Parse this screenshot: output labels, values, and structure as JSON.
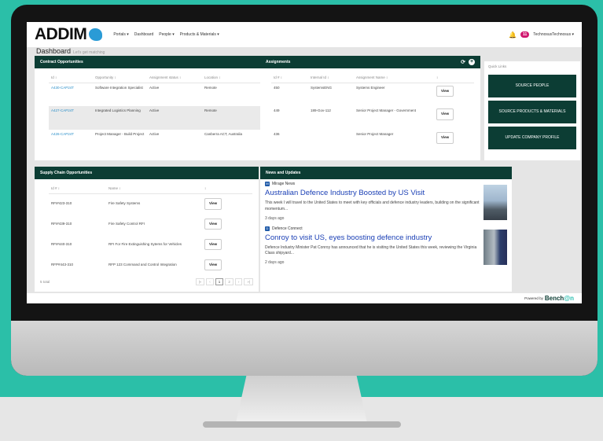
{
  "app": {
    "logo_text": "ADDIM"
  },
  "nav": {
    "links": [
      "Portals ▾",
      "Dashboard",
      "People ▾",
      "Products & Materials ▾"
    ],
    "notification_count": "11",
    "user_label": "TechnosusTechnosus ▾"
  },
  "page": {
    "title": "Dashboard",
    "subtitle": "Let's get matching"
  },
  "contracts": {
    "title": "Contract Opportunities",
    "columns": [
      "Id ↕",
      "Opportunity ↕",
      "Assignment status ↕",
      "Location ↕"
    ],
    "rows": [
      {
        "id": "A430-CAP24T",
        "opportunity": "Software Integration Specialist",
        "status": "Active",
        "location": "Remote"
      },
      {
        "id": "A427-CAP24T",
        "opportunity": "Integrated Logistics Planning",
        "status": "Active",
        "location": "Remote"
      },
      {
        "id": "A426-CAP24T",
        "opportunity": "Project Manager - Build Project",
        "status": "Active",
        "location": "Canberra ACT, Australia"
      }
    ]
  },
  "assignments": {
    "title": "Assignments",
    "columns": [
      "Id # ↕",
      "Internal Id ↕",
      "Assignment Name ↕",
      "↕"
    ],
    "rows": [
      {
        "id": "450",
        "internal_id": "SystemsENG",
        "name": "Systems Engineer",
        "action": "View"
      },
      {
        "id": "449",
        "internal_id": "189-Gov-112",
        "name": "Senior Project Manager - Government",
        "action": "View"
      },
      {
        "id": "436",
        "internal_id": "",
        "name": "Senior Project Manager",
        "action": "View"
      }
    ]
  },
  "quick_links": {
    "title": "Quick Links",
    "items": [
      "SOURCE PEOPLE",
      "SOURCE PRODUCTS & MATERIALS",
      "UPDATE COMPANY PROFILE"
    ]
  },
  "supply": {
    "title": "Supply Chain Opportunities",
    "columns": [
      "Id # ↕",
      "Name ↕",
      "↕"
    ],
    "rows": [
      {
        "id": "RFI#423-310",
        "name": "Fire Safety Systems",
        "action": "View"
      },
      {
        "id": "RFI#439-310",
        "name": "Fire Safety Control RFI",
        "action": "View"
      },
      {
        "id": "RFI#440-310",
        "name": "RFI For Fire Extinguishing Sytems for Vehicles",
        "action": "View"
      },
      {
        "id": "RFP#443-310",
        "name": "RFP 123 Command and Control Integration",
        "action": "View"
      }
    ],
    "total": "5 total",
    "pager": [
      "|«",
      "‹",
      "1",
      "2",
      "›",
      "»|"
    ]
  },
  "news": {
    "title": "News and Updates",
    "items": [
      {
        "source": "Mirage News",
        "headline": "Australian Defence Industry Boosted by US Visit",
        "body": "This week I will travel to the United States to meet with key officials and defence industry leaders, building on the significant momentum...",
        "age": "3 days ago"
      },
      {
        "source": "Defence Connect",
        "headline": "Conroy to visit US, eyes boosting defence industry",
        "body": "Defence Industry Minister Pat Conroy has announced that he is visiting the United States this week, reviewing the Virginia Class shipyard...",
        "age": "2 days ago"
      }
    ]
  },
  "footer": {
    "powered_by": "Powered by",
    "brand_a": "Bench",
    "brand_b": "@n"
  },
  "colors": {
    "header_green": "#0c3d34",
    "link_blue": "#2a8fc9",
    "headline_blue": "#1a3fb5",
    "badge_pink": "#d0186f",
    "background_teal": "#2bbfa8"
  }
}
